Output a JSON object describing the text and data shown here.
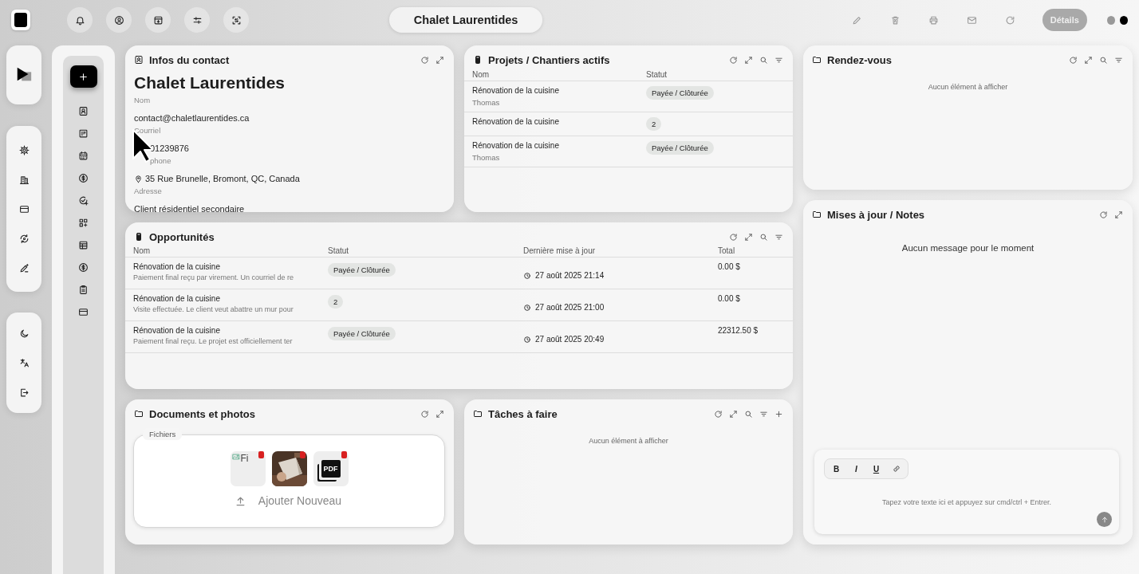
{
  "header": {
    "title": "Chalet Laurentides",
    "details_button": "Détails"
  },
  "contact": {
    "title": "Infos du contact",
    "name": "Chalet Laurentides",
    "name_label": "Nom",
    "fields": [
      {
        "kind": "text",
        "value": "contact@chaletlaurentides.ca",
        "label": "Courriel"
      },
      {
        "kind": "covered",
        "value": "01239876",
        "label": "phone"
      },
      {
        "kind": "address",
        "value": "35 Rue Brunelle, Bromont, QC, Canada",
        "label": "Adresse"
      },
      {
        "kind": "text",
        "value": "Client résidentiel secondaire"
      }
    ]
  },
  "projects": {
    "title": "Projets / Chantiers actifs",
    "columns": [
      "Nom",
      "Statut"
    ],
    "rows": [
      {
        "name": "Rénovation de la cuisine",
        "subtitle": "Thomas",
        "status": "Payée / Clôturée"
      },
      {
        "name": "Rénovation de la cuisine",
        "status": "2"
      },
      {
        "name": "Rénovation de la cuisine",
        "subtitle": "Thomas",
        "status": "Payée / Clôturée"
      }
    ]
  },
  "appointments": {
    "title": "Rendez-vous",
    "empty": "Aucun élément à afficher"
  },
  "opportunities": {
    "title": "Opportunités",
    "columns": [
      "Nom",
      "Statut",
      "Dernière mise à jour",
      "Total"
    ],
    "rows": [
      {
        "name": "Rénovation de la cuisine",
        "note": "Paiement final reçu par virement. Un courriel de re",
        "status": "Payée / Clôturée",
        "updated": "27 août 2025 21:14",
        "total": "0.00 $"
      },
      {
        "name": "Rénovation de la cuisine",
        "note": "Visite effectuée. Le client veut abattre un mur pour",
        "status": "2",
        "updated": "27 août 2025 21:00",
        "total": "0.00 $"
      },
      {
        "name": "Rénovation de la cuisine",
        "note": "Paiement final reçu. Le projet est officiellement ter",
        "status": "Payée / Clôturée",
        "updated": "27 août 2025 20:49",
        "total": "22312.50 $"
      }
    ]
  },
  "notes": {
    "title": "Mises à jour / Notes",
    "empty": "Aucun message pour le moment",
    "editor": {
      "tools": [
        "B",
        "I",
        "U"
      ],
      "placeholder": "Tapez votre texte ici et appuyez sur cmd/ctrl + Entrer."
    }
  },
  "documents": {
    "title": "Documents et photos",
    "group_label": "Fichiers",
    "files": [
      {
        "kind": "broken",
        "alt": "Fi"
      },
      {
        "kind": "picture"
      },
      {
        "kind": "pdf",
        "label": "PDF"
      }
    ],
    "add_label": "Ajouter Nouveau"
  },
  "tasks": {
    "title": "Tâches à faire",
    "empty": "Aucun élément à afficher"
  }
}
